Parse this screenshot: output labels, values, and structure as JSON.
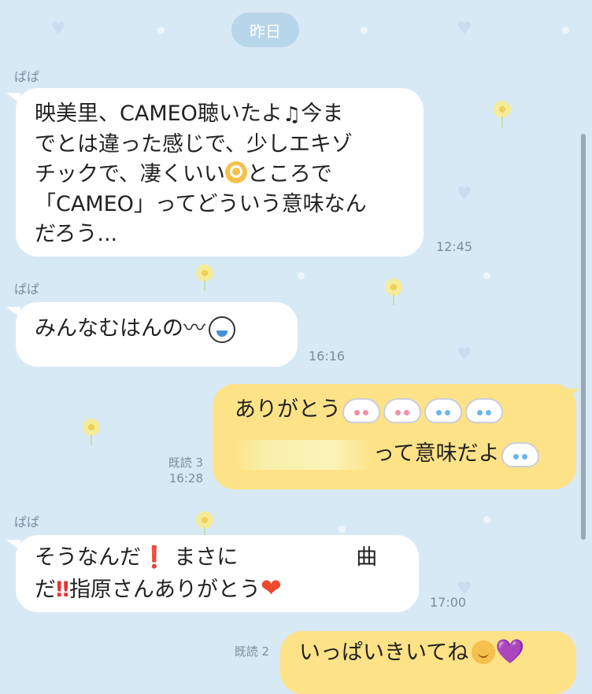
{
  "date_separator": "昨日",
  "messages": [
    {
      "sender": "ぱぱ",
      "time": "12:45",
      "lines": [
        "映美里、CAMEO聴いたよ",
        "♫",
        "今ま",
        "でとは違った感じで、少しエキゾ",
        "チックで、凄くいい",
        "ところで",
        "「CAMEO」ってどういう意味なん",
        "だろう..."
      ]
    },
    {
      "sender": "ぱぱ",
      "time": "16:16",
      "text": "みんなむはんの",
      "squiggle": "〰"
    },
    {
      "read": "既読 3",
      "time": "16:28",
      "line1": "ありがとう",
      "line2": "って意味だよ"
    },
    {
      "sender": "ぱぱ",
      "time": "17:00",
      "line1a": "そうなんだ",
      "excl1": "❗",
      "line1b": "まさに",
      "line1c": "曲",
      "line2a": "だ",
      "excl2": "‼",
      "line2b": "指原さんありがとう",
      "heart": "❤"
    },
    {
      "read": "既読 2",
      "text": "いっぱいきいてね",
      "heart": "💜"
    }
  ],
  "icons": [
    "music-note-icon",
    "ok-hand-icon",
    "bunny-emoji-icon",
    "crying-face-icon",
    "heart-icon",
    "smile-icon"
  ],
  "colors": {
    "background": "#d8e9f6",
    "incoming": "#ffffff",
    "outgoing": "#fde287",
    "date_pill": "#b8d6ea"
  }
}
